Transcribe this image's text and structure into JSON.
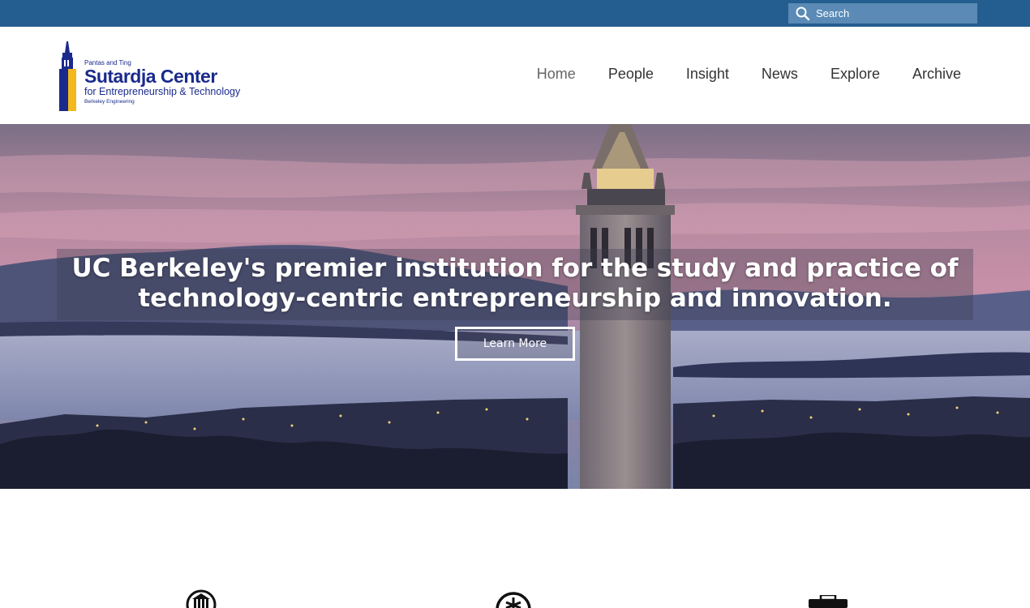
{
  "search": {
    "placeholder": "Search"
  },
  "logo": {
    "prefix": "Pantas and Ting",
    "name": "Sutardja Center",
    "subtitle": "for Entrepreneurship & Technology",
    "org": "Berkeley Engineering"
  },
  "nav": {
    "items": [
      {
        "label": "Home",
        "active": true
      },
      {
        "label": "People",
        "active": false
      },
      {
        "label": "Insight",
        "active": false
      },
      {
        "label": "News",
        "active": false
      },
      {
        "label": "Explore",
        "active": false
      },
      {
        "label": "Archive",
        "active": false
      }
    ]
  },
  "hero": {
    "headline_line1": "UC Berkeley's premier institution for the study and practice of",
    "headline_line2": "technology-centric entrepreneurship and innovation.",
    "button_label": "Learn More"
  },
  "features": {
    "icons": [
      "building-icon",
      "compass-icon",
      "briefcase-icon"
    ]
  },
  "colors": {
    "topbar": "#245e90",
    "search_bg": "#5a8ab5",
    "brand_blue": "#1a2a8c",
    "brand_gold": "#f2b81c"
  }
}
